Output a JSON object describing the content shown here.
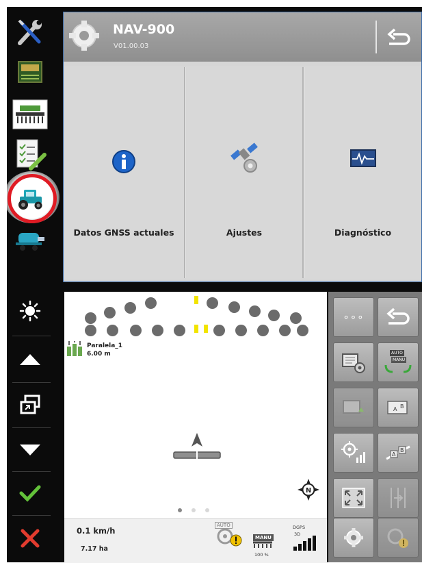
{
  "colors": {
    "frame": "#0b0b0b",
    "highlight_ring": "#e01b24",
    "window_border": "#3a6aa8",
    "confirm_green": "#63c23a",
    "cancel_red": "#e23b2e",
    "info_blue": "#1d64c8"
  },
  "sidebar": {
    "items": [
      {
        "icon": "wrench-screwdriver-icon"
      },
      {
        "icon": "field-map-icon"
      },
      {
        "icon": "seeder-implement-icon"
      },
      {
        "icon": "task-checklist-icon"
      },
      {
        "icon": "tractor-icon",
        "selected": true
      },
      {
        "icon": "sprayer-tank-icon"
      }
    ],
    "controls": [
      {
        "icon": "brightness-sun-icon"
      },
      {
        "icon": "arrow-up-icon"
      },
      {
        "icon": "switch-windows-icon"
      },
      {
        "icon": "arrow-down-icon"
      },
      {
        "icon": "checkmark-icon"
      },
      {
        "icon": "close-x-icon"
      }
    ]
  },
  "app": {
    "title": "NAV-900",
    "version": "V01.00.03",
    "tiles": [
      {
        "label": "Datos GNSS actuales",
        "icon": "info-icon"
      },
      {
        "label": "Ajustes",
        "icon": "satellite-settings-icon"
      },
      {
        "label": "Diagnóstico",
        "icon": "diagnostic-monitor-icon"
      }
    ]
  },
  "map": {
    "line_name": "Paralela_1",
    "line_width": "6.00 m",
    "speed": "0.1 km/h",
    "area": "7.17 ha",
    "steering_mode": "AUTO",
    "manual_label": "MANU",
    "manual_percent": "100 %",
    "gps_label": "DGPS",
    "gps_sublabel": "3D",
    "compass_label": "N",
    "page_dots": 3,
    "active_page": 0
  },
  "panel": {
    "more_label": "∘∘∘",
    "auto_label": "AUTO",
    "manu_label": "MANU"
  }
}
